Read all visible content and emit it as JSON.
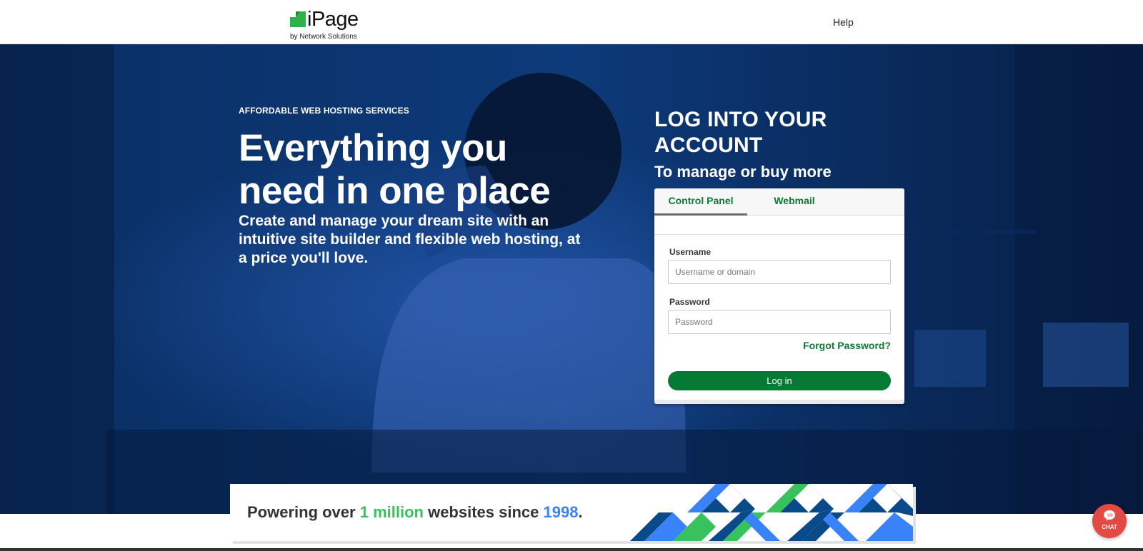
{
  "header": {
    "logo": {
      "word": "iPage",
      "sub": "by Network Solutions"
    },
    "help_label": "Help"
  },
  "hero": {
    "eyebrow": "AFFORDABLE WEB HOSTING SERVICES",
    "headline": "Everything you need in one place",
    "subhead": "Create and manage your dream site with an intuitive site builder and flexible web hosting, at a price you'll love."
  },
  "login": {
    "title": "LOG INTO YOUR ACCOUNT",
    "subtitle": "To manage or buy more",
    "tabs": [
      {
        "label": "Control Panel",
        "active": true
      },
      {
        "label": "Webmail",
        "active": false
      }
    ],
    "username": {
      "label": "Username",
      "placeholder": "Username or domain",
      "value": ""
    },
    "password": {
      "label": "Password",
      "placeholder": "Password",
      "value": ""
    },
    "forgot_label": "Forgot Password?",
    "button_label": "Log in"
  },
  "banner": {
    "text_1": "Powering over ",
    "highlight_1": "1 million",
    "text_2": " websites since ",
    "highlight_2": "1998",
    "text_3": "."
  },
  "chat": {
    "label": "CHAT"
  },
  "colors": {
    "brand_green": "#057a34",
    "accent_green": "#37c25e",
    "accent_blue": "#3a82f7",
    "hero_blue": "#0b2f66",
    "chat_red": "#e34a44"
  }
}
